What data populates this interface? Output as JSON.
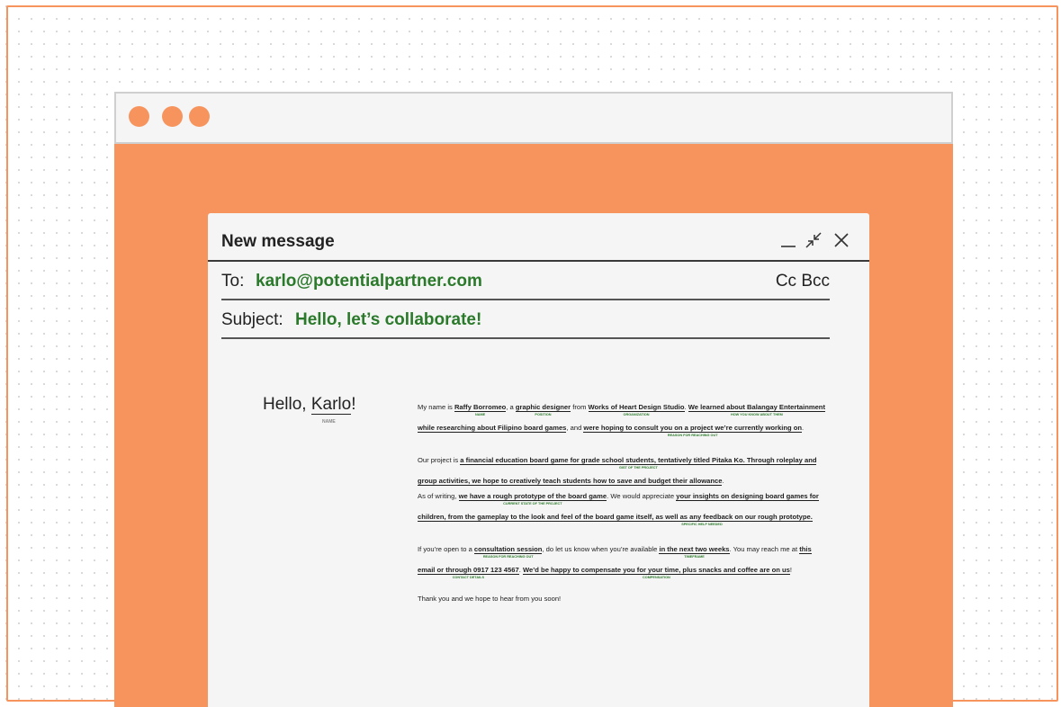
{
  "compose": {
    "title": "New message",
    "to_label": "To:",
    "to_value": "karlo@potentialpartner.com",
    "ccbcc_label": "Cc Bcc",
    "subject_label": "Subject:",
    "subject_value": "Hello, let’s collaborate!"
  },
  "greeting": {
    "prefix": "Hello, ",
    "name": "Karlo",
    "suffix": "!",
    "tag": "NAME"
  },
  "body": {
    "p1": {
      "t0": "My name is ",
      "name": "Raffy Borromeo",
      "name_tag": "NAME",
      "t1": ", a ",
      "position": "graphic designer",
      "position_tag": "POSITION",
      "t2": " from ",
      "org": "Works of Heart Design Studio",
      "org_tag": "ORGANIZATION",
      "t3": ". ",
      "how": "We learned about Balangay Entertainment",
      "how_tag": "HOW YOU KNOW ABOUT THEM",
      "how2": "while researching about Filipino board games",
      "t4": ", and ",
      "reason": "were hoping to consult you on a project we’re currently working on",
      "reason_tag": "REASON FOR REACHING OUT",
      "t5": "."
    },
    "p2": {
      "t0": "Our project is ",
      "gist": "a financial education board game for grade school students, tentatively titled Pitaka Ko. Through roleplay and",
      "gist_tag": "GIST OF THE PROJECT",
      "gist2": "group activities, we hope to creatively teach students how to save and budget their allowance",
      "t1": "."
    },
    "p3": {
      "t0": "As of writing, ",
      "state": "we have a rough prototype of the board game",
      "state_tag": "CURRENT STATE OF THE PROJECT",
      "t1": ". We would appreciate ",
      "help": "your insights on designing board games for",
      "help2": "children, from the gameplay to the look and feel of the board game itself, as well as any feedback on our rough prototype.",
      "help_tag": "SPECIFIC HELP NEEDED"
    },
    "p4": {
      "t0": "If you’re open to a ",
      "session": "consultation session",
      "session_tag": "REASON FOR REACHING OUT",
      "t1": ", do let us know when you’re available ",
      "time": "in the next two weeks",
      "time_tag": "TIMEFRAME",
      "t2": ". You may reach me at ",
      "contact": "this",
      "contact2": "email or through 0917 123 4567",
      "contact_tag": "CONTACT DETAILS",
      "t3": ". ",
      "comp": "We’d be happy to compensate you for your time, plus snacks and coffee are on us",
      "comp_tag": "COMPENSATION",
      "t4": "!"
    },
    "p5": "Thank you and we hope to hear from you soon!"
  },
  "colors": {
    "accent": "#f7945e",
    "highlight_green": "#2b7a2b",
    "panel": "#f5f5f5"
  },
  "icons": [
    "minimize-icon",
    "shrink-icon",
    "close-icon"
  ]
}
